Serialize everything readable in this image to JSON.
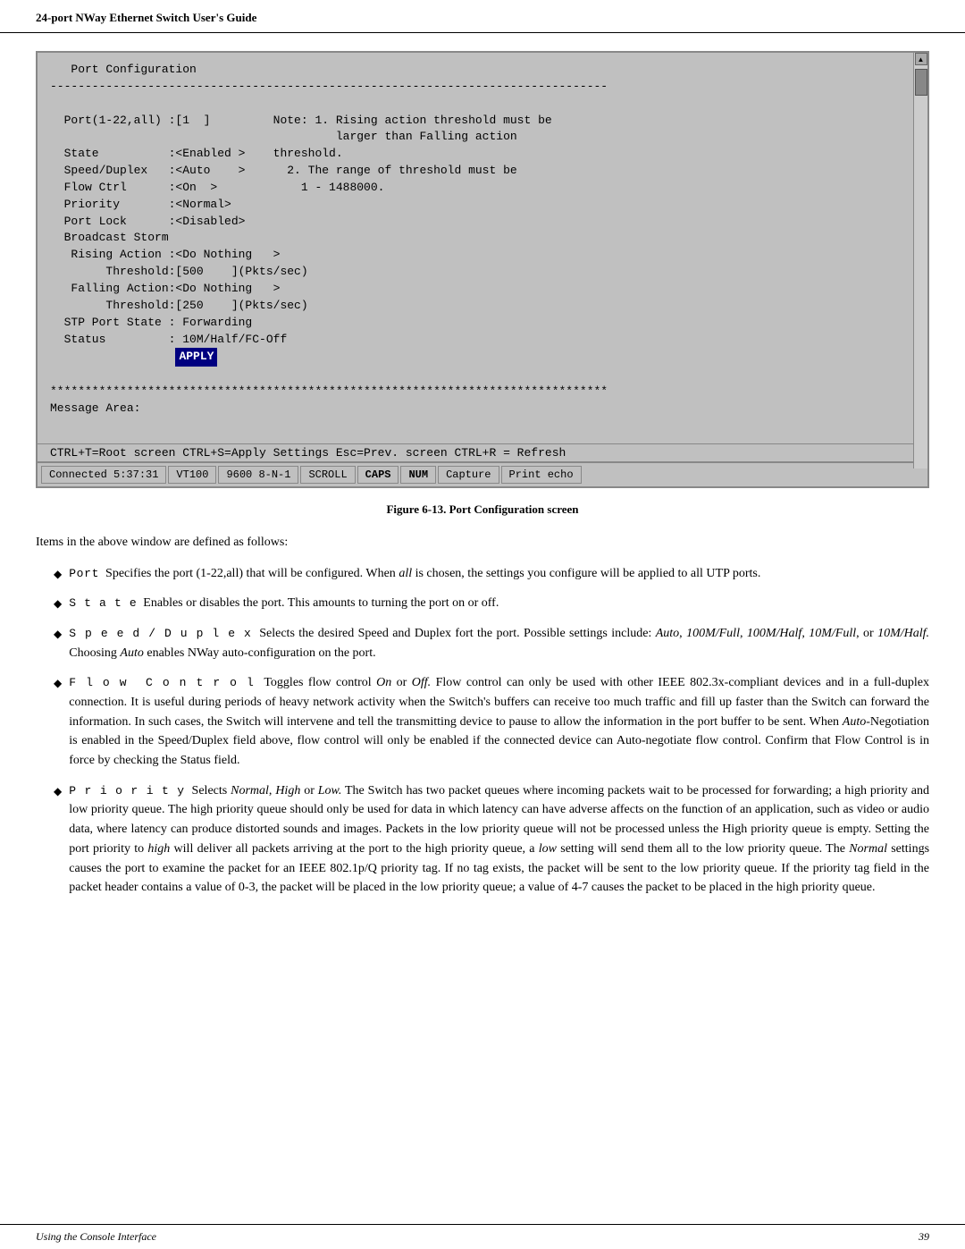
{
  "header": {
    "title": "24-port NWay Ethernet Switch User's Guide"
  },
  "terminal": {
    "title": "Port Configuration",
    "separator": "--------------------------------------------------------------------------------",
    "fields": [
      {
        "label": "Port(1-22,all) :[1  ]",
        "note1": "Note: 1. Rising action threshold must be"
      },
      {
        "note2": "                              larger than Falling action"
      },
      {
        "label": "State         :<Enabled >",
        "note3": "threshold."
      },
      {
        "label": "Speed/Duplex  :<Auto    >",
        "note4": "     2. The range of threshold must be"
      },
      {
        "label": "Flow Ctrl     :<On  >",
        "note5": "        1 - 1488000."
      },
      {
        "label": "Priority      :<Normal>"
      },
      {
        "label": "Port Lock     :<Disabled>"
      },
      {
        "label": "Broadcast Storm"
      },
      {
        "label": " Rising Action :<Do Nothing   >"
      },
      {
        "label": "      Threshold:[500    ](Pkts/sec)"
      },
      {
        "label": " Falling Action:<Do Nothing   >"
      },
      {
        "label": "      Threshold:[250    ](Pkts/sec)"
      },
      {
        "label": "STP Port State : Forwarding"
      },
      {
        "label": "Status         : 10M/Half/FC-Off"
      }
    ],
    "apply_btn": "APPLY",
    "stars": "********************************************************************************",
    "message_area": "Message Area:",
    "bottom_bar": "CTRL+T=Root screen    CTRL+S=Apply Settings    Esc=Prev. screen  CTRL+R = Refresh"
  },
  "status_bar": {
    "connected": "Connected 5:37:31",
    "protocol": "VT100",
    "baud": "9600 8-N-1",
    "scroll": "SCROLL",
    "caps": "CAPS",
    "num": "NUM",
    "capture": "Capture",
    "print_echo": "Print echo"
  },
  "figure_caption": "Figure 6-13.  Port Configuration screen",
  "intro_text": "Items in the above window are defined as follows:",
  "bullets": [
    {
      "id": "port",
      "label": "Port",
      "label_style": "mono",
      "text": "Specifies the port (1-22,all) that will be configured. When ",
      "italic_part": "all",
      "text2": " is chosen, the settings you configure will be applied to all UTP ports."
    },
    {
      "id": "state",
      "label": "State",
      "label_style": "mono",
      "text": "Enables or disables the port. This amounts to turning the port on or off."
    },
    {
      "id": "speed-duplex",
      "label": "Speed/Duplex",
      "label_style": "mono",
      "text": "Selects the desired Speed and Duplex fort the port. Possible settings include: ",
      "italic_part": "Auto, 100M/Full, 100M/Half, 10M/Full,",
      "text2": " or ",
      "italic_part2": "10M/Half.",
      "text3": " Choosing ",
      "italic_part3": "Auto",
      "text4": " enables NWay auto-configuration on the port."
    },
    {
      "id": "flow-control",
      "label": "Flow Control",
      "label_style": "mono",
      "text": "Toggles flow control ",
      "italic_part": "On",
      "text2": " or ",
      "italic_part2": "Off.",
      "text3": " Flow control can only be used with other IEEE 802.3x-compliant devices and in a full-duplex connection. It is useful during periods of heavy network activity when the Switch's buffers can receive too much traffic and fill up faster than the Switch can forward the information. In such cases, the Switch will intervene and tell the transmitting device to pause to allow the information in the port buffer to be sent. When ",
      "italic_part3": "Auto",
      "text4": "-Negotiation is enabled in the Speed/Duplex field above, flow control will only be enabled if the connected device can Auto-negotiate flow control. Confirm that Flow Control is in force by checking the Status field."
    },
    {
      "id": "priority",
      "label": "Priority",
      "label_style": "mono",
      "text": "Selects ",
      "italic_part": "Normal, High",
      "text2": " or ",
      "italic_part2": "Low.",
      "text3": " The Switch has two packet queues where incoming packets wait to be processed for forwarding; a high priority and low priority queue. The high priority queue should only be used for data in which latency can have adverse affects on the function of an application, such as video or audio data, where latency can produce distorted sounds and images. Packets in the low priority queue will not be processed unless the High priority queue is empty. Setting the port priority to ",
      "italic_part3": "high",
      "text4": " will deliver all packets arriving at the port to the high priority queue, a ",
      "italic_part4": "low",
      "text5": " setting will send them all to the low priority queue. The ",
      "italic_part5": "Normal",
      "text6": " settings causes the port to examine the packet for an IEEE 802.1p/Q priority tag. If no tag exists, the packet will be sent to the low priority queue. If the priority tag field in the packet header contains a value of 0-3, the packet will be placed in the low priority queue; a value of 4-7 causes the packet to be placed in the high priority queue."
    }
  ],
  "footer": {
    "left": "Using the Console Interface",
    "right": "39"
  }
}
